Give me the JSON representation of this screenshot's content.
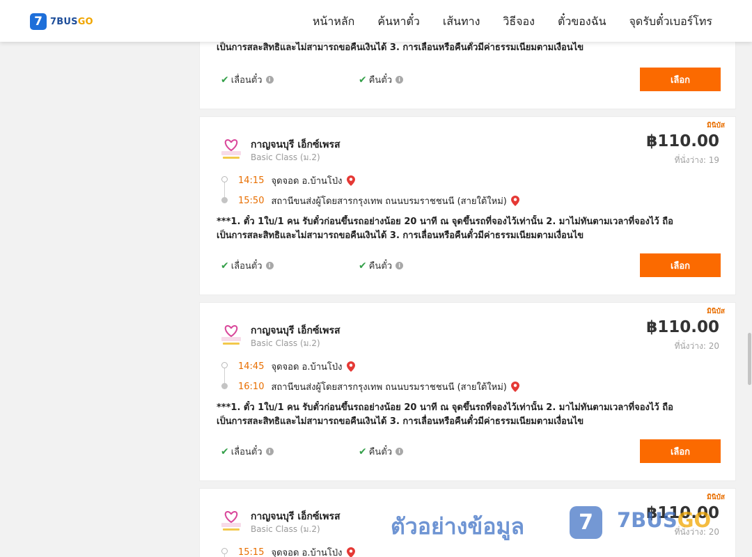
{
  "header": {
    "logo_mark": "7",
    "logo_text_a": "7BUS",
    "logo_text_b": "GO",
    "nav": [
      "หน้าหลัก",
      "ค้นหาตั๋ว",
      "เส้นทาง",
      "วิธีจอง",
      "ตั๋วของฉัน",
      "จุดรับตั๋วเบอร์โทร"
    ]
  },
  "top_card": {
    "note_line2": "เป็นการสละสิทธิและไม่สามารถขอคืนเงินได้ 3. การเลื่อนหรือคืนตั๋วมีค่าธรรมเนียมตามเงื่อนไข",
    "reschedule": "เลื่อนตั๋ว",
    "refund": "คืนตั๋ว",
    "select": "เลือก"
  },
  "trips": [
    {
      "badge": "มินิบัส",
      "operator": "กาญจนบุรี เอ็กซ์เพรส",
      "bus_class": "Basic Class (ม.2)",
      "price": "฿110.00",
      "seats": "ที่นั่งว่าง: 19",
      "depart_time": "14:15",
      "depart_place": "จุดจอด อ.บ้านโป่ง",
      "arrive_time": "15:50",
      "arrive_place": "สถานีขนส่งผู้โดยสารกรุงเทพ ถนนบรมราชชนนี (สายใต้ใหม่)",
      "note_line1": "***1. ตั๋ว 1ใบ/1 คน รับตั๋วก่อนขึ้นรถอย่างน้อย 20 นาที ณ จุดขึ้นรถที่จองไว้เท่านั้น 2. มาไม่ทันตามเวลาที่จองไว้ ถือ",
      "note_line2": "เป็นการสละสิทธิและไม่สามารถขอคืนเงินได้ 3. การเลื่อนหรือคืนตั๋วมีค่าธรรมเนียมตามเงื่อนไข",
      "reschedule": "เลื่อนตั๋ว",
      "refund": "คืนตั๋ว",
      "select": "เลือก"
    },
    {
      "badge": "มินิบัส",
      "operator": "กาญจนบุรี เอ็กซ์เพรส",
      "bus_class": "Basic Class (ม.2)",
      "price": "฿110.00",
      "seats": "ที่นั่งว่าง: 20",
      "depart_time": "14:45",
      "depart_place": "จุดจอด อ.บ้านโป่ง",
      "arrive_time": "16:10",
      "arrive_place": "สถานีขนส่งผู้โดยสารกรุงเทพ ถนนบรมราชชนนี (สายใต้ใหม่)",
      "note_line1": "***1. ตั๋ว 1ใบ/1 คน รับตั๋วก่อนขึ้นรถอย่างน้อย 20 นาที ณ จุดขึ้นรถที่จองไว้เท่านั้น 2. มาไม่ทันตามเวลาที่จองไว้ ถือ",
      "note_line2": "เป็นการสละสิทธิและไม่สามารถขอคืนเงินได้ 3. การเลื่อนหรือคืนตั๋วมีค่าธรรมเนียมตามเงื่อนไข",
      "reschedule": "เลื่อนตั๋ว",
      "refund": "คืนตั๋ว",
      "select": "เลือก"
    },
    {
      "badge": "มินิบัส",
      "operator": "กาญจนบุรี เอ็กซ์เพรส",
      "bus_class": "Basic Class (ม.2)",
      "price": "฿110.00",
      "seats": "ที่นั่งว่าง: 20",
      "depart_time": "15:15",
      "depart_place": "จุดจอด อ.บ้านโป่ง"
    }
  ],
  "watermark": {
    "text": "ตัวอย่างข้อมูล",
    "badge": "7",
    "brand_a": "7BUS",
    "brand_b": "GO"
  },
  "icons": {
    "check": "check-icon",
    "info": "info-icon",
    "pin": "map-pin-icon",
    "operator_logo": "heart-logo-icon"
  },
  "colors": {
    "accent": "#fb6a00",
    "time": "#e86e00",
    "check": "#35a04a",
    "pin": "#e53935",
    "brand_blue": "#1e6fd9"
  }
}
